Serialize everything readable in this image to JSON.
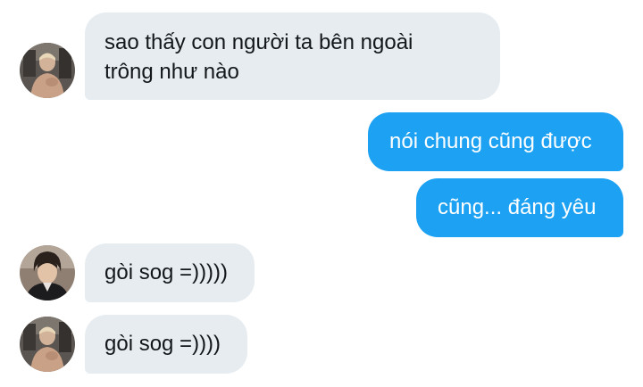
{
  "conversation": {
    "messages": [
      {
        "direction": "incoming",
        "avatar": "avatar-sender-a",
        "lines": [
          "sao thấy con người ta bên ngoài",
          "trông như nào"
        ]
      },
      {
        "direction": "outgoing",
        "lines": [
          "nói chung cũng được"
        ]
      },
      {
        "direction": "outgoing",
        "lines": [
          "cũng... đáng yêu"
        ]
      },
      {
        "direction": "incoming",
        "avatar": "avatar-sender-b",
        "lines": [
          "gòi sog =)))))"
        ]
      },
      {
        "direction": "incoming",
        "avatar": "avatar-sender-a",
        "lines": [
          "gòi sog =))))"
        ]
      }
    ]
  },
  "theme": {
    "incoming_bubble_color": "#e6ecf0",
    "outgoing_bubble_color": "#1da1f2",
    "incoming_text_color": "#14171a",
    "outgoing_text_color": "#ffffff"
  }
}
